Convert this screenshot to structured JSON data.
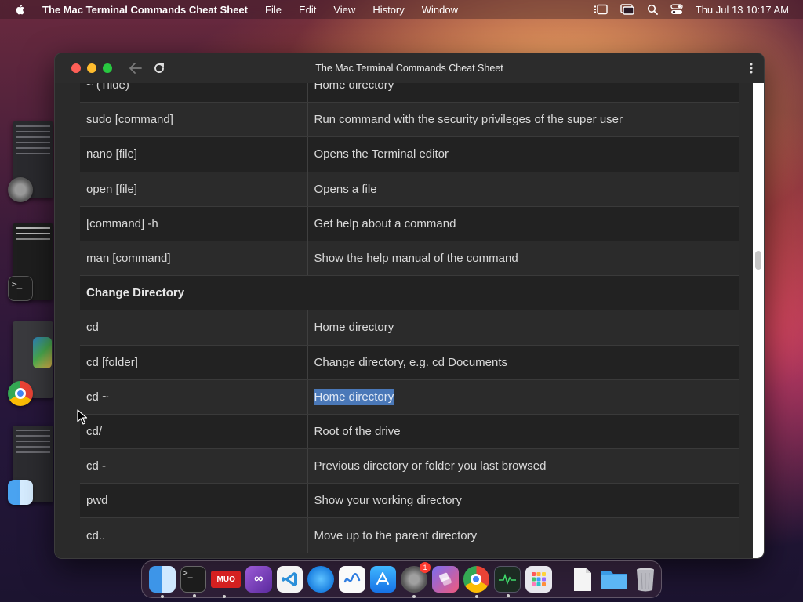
{
  "menubar": {
    "app_name": "The Mac Terminal Commands Cheat Sheet",
    "menus": [
      "File",
      "Edit",
      "View",
      "History",
      "Window"
    ],
    "clock": "Thu Jul 13  10:17 AM"
  },
  "window": {
    "title": "The Mac Terminal Commands Cheat Sheet"
  },
  "table": {
    "rows": [
      {
        "cmd": "~ (Tilde)",
        "desc": "Home directory",
        "section": false
      },
      {
        "cmd": "sudo [command]",
        "desc": "Run command with the security privileges of the super user",
        "section": false
      },
      {
        "cmd": "nano [file]",
        "desc": "Opens the Terminal editor",
        "section": false
      },
      {
        "cmd": "open [file]",
        "desc": "Opens a file",
        "section": false
      },
      {
        "cmd": "[command] -h",
        "desc": "Get help about a command",
        "section": false
      },
      {
        "cmd": "man [command]",
        "desc": "Show the help manual of the command",
        "section": false
      },
      {
        "cmd": "Change Directory",
        "desc": "",
        "section": true
      },
      {
        "cmd": "cd",
        "desc": "Home directory",
        "section": false
      },
      {
        "cmd": "cd [folder]",
        "desc": "Change directory, e.g. cd Documents",
        "section": false
      },
      {
        "cmd": "cd ~",
        "desc": "Home directory",
        "section": false,
        "selected": true
      },
      {
        "cmd": "cd/",
        "desc": "Root of the drive",
        "section": false
      },
      {
        "cmd": "cd -",
        "desc": "Previous directory or folder you last browsed",
        "section": false
      },
      {
        "cmd": "pwd",
        "desc": "Show your working directory",
        "section": false
      },
      {
        "cmd": "cd..",
        "desc": "Move up to the parent directory",
        "section": false
      }
    ]
  },
  "dock": {
    "items": [
      "finder-icon",
      "terminal-icon",
      "muo-icon",
      "visual-studio-icon",
      "vscode-icon",
      "safari-icon",
      "freeform-icon",
      "app-store-icon",
      "system-settings-icon",
      "shortcuts-icon",
      "chrome-icon",
      "activity-monitor-icon",
      "launchpad-icon",
      "document-icon",
      "folder-icon",
      "trash-icon"
    ],
    "settings_badge": "1",
    "muo_label": "MUO"
  },
  "colors": {
    "selection": "#4a78b8",
    "close": "#fe5f57",
    "minimize": "#febc2e",
    "maximize": "#28c840"
  }
}
